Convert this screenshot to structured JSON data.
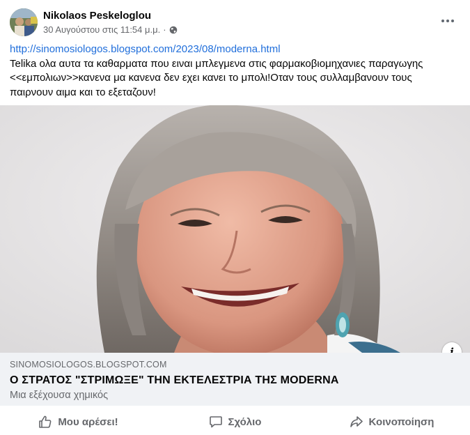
{
  "post": {
    "author": "Nikolaos Peskeloglou",
    "timestamp": "30 Αυγούστου στις 11:54 μ.μ.",
    "separator": "·",
    "privacy_icon": "globe-icon",
    "url": "http://sinomosiologos.blogspot.com/2023/08/moderna.html",
    "body_line1": "Telika ολα αυτα τα καθαρματα που ειναι μπλεγμενα στις φαρμακοβιομηχανιες παραγωγης",
    "body_line2": "<<εμπολιων>>κανενα μα κανενα δεν εχει κανει το μπολι!Οταν τους συλλαμβανουν τους",
    "body_line3": "παιρνουν αιμα και το εξεταζουν!"
  },
  "link_preview": {
    "domain": "SINOMOSIOLOGOS.BLOGSPOT.COM",
    "title": "Ο ΣΤΡΑΤΟΣ \"ΣΤΡΙΜΩΞΕ\" ΤΗΝ ΕΚΤΕΛΕΣΤΡΙΑ ΤΗΣ MODERNA",
    "description": "Μια εξέχουσα χημικός",
    "info_label": "i"
  },
  "actions": {
    "like": "Μου αρέσει!",
    "comment": "Σχόλιο",
    "share": "Κοινοποίηση"
  },
  "colors": {
    "link": "#216fdb",
    "secondary_text": "#65676b",
    "preview_bg": "#f0f2f5"
  }
}
